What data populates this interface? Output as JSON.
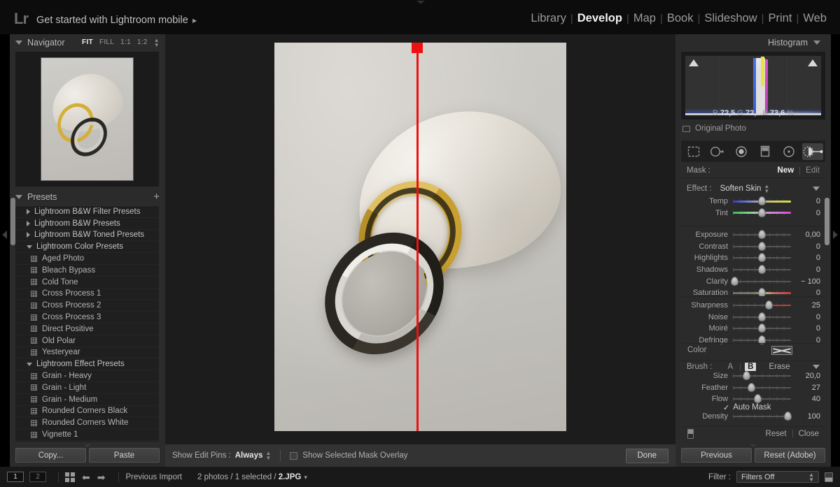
{
  "app": {
    "logo": "Lr",
    "identity_plate": "Get started with Lightroom mobile",
    "identity_arrow": "▶"
  },
  "modules": [
    {
      "label": "Library",
      "active": false
    },
    {
      "label": "Develop",
      "active": true
    },
    {
      "label": "Map",
      "active": false
    },
    {
      "label": "Book",
      "active": false
    },
    {
      "label": "Slideshow",
      "active": false
    },
    {
      "label": "Print",
      "active": false
    },
    {
      "label": "Web",
      "active": false
    }
  ],
  "module_separator": "|",
  "left_panel": {
    "navigator": {
      "title": "Navigator",
      "zoom_levels": [
        {
          "label": "FIT",
          "active": true
        },
        {
          "label": "FILL",
          "active": false
        },
        {
          "label": "1:1",
          "active": false
        },
        {
          "label": "1:2",
          "active": false
        }
      ]
    },
    "presets": {
      "title": "Presets",
      "add_label": "+",
      "items": [
        {
          "label": "Lightroom B&W Filter Presets",
          "type": "group",
          "expanded": false
        },
        {
          "label": "Lightroom B&W Presets",
          "type": "group",
          "expanded": false
        },
        {
          "label": "Lightroom B&W Toned Presets",
          "type": "group",
          "expanded": false
        },
        {
          "label": "Lightroom Color Presets",
          "type": "group",
          "expanded": true
        },
        {
          "label": "Aged Photo",
          "type": "preset"
        },
        {
          "label": "Bleach Bypass",
          "type": "preset"
        },
        {
          "label": "Cold Tone",
          "type": "preset"
        },
        {
          "label": "Cross Process 1",
          "type": "preset"
        },
        {
          "label": "Cross Process 2",
          "type": "preset"
        },
        {
          "label": "Cross Process 3",
          "type": "preset"
        },
        {
          "label": "Direct Positive",
          "type": "preset"
        },
        {
          "label": "Old Polar",
          "type": "preset"
        },
        {
          "label": "Yesteryear",
          "type": "preset"
        },
        {
          "label": "Lightroom Effect Presets",
          "type": "group",
          "expanded": true
        },
        {
          "label": "Grain - Heavy",
          "type": "preset"
        },
        {
          "label": "Grain - Light",
          "type": "preset"
        },
        {
          "label": "Grain - Medium",
          "type": "preset"
        },
        {
          "label": "Rounded Corners Black",
          "type": "preset"
        },
        {
          "label": "Rounded Corners White",
          "type": "preset"
        },
        {
          "label": "Vignette 1",
          "type": "preset"
        }
      ]
    },
    "buttons": {
      "copy": "Copy...",
      "paste": "Paste"
    }
  },
  "toolbar": {
    "show_edit_pins_label": "Show Edit Pins :",
    "show_edit_pins_value": "Always",
    "mask_overlay_label": "Show Selected Mask Overlay",
    "mask_overlay_checked": false,
    "done_label": "Done"
  },
  "right_panel": {
    "histogram": {
      "title": "Histogram",
      "readout_r_label": "R",
      "readout_r": "72,5",
      "readout_g_label": "G",
      "readout_g": "72,0",
      "readout_b_label": "B",
      "readout_b": "73,6",
      "readout_unit": "%",
      "original_photo_label": "Original Photo"
    },
    "tools": [
      {
        "name": "crop-overlay-tool",
        "active": false
      },
      {
        "name": "spot-removal-tool",
        "active": false
      },
      {
        "name": "red-eye-correction-tool",
        "active": false
      },
      {
        "name": "graduated-filter-tool",
        "active": false
      },
      {
        "name": "radial-filter-tool",
        "active": false
      },
      {
        "name": "adjustment-brush-tool",
        "active": true
      }
    ],
    "mask": {
      "label": "Mask :",
      "new_label": "New",
      "edit_label": "Edit",
      "separator": "|"
    },
    "effect": {
      "label": "Effect :",
      "value": "Soften Skin"
    },
    "sliders_group_1": [
      {
        "name": "Temp",
        "value": "0",
        "pos": 50,
        "grad": "grad-temp"
      },
      {
        "name": "Tint",
        "value": "0",
        "pos": 50,
        "grad": "grad-tint"
      }
    ],
    "sliders_group_2": [
      {
        "name": "Exposure",
        "value": "0,00",
        "pos": 50,
        "grad": ""
      },
      {
        "name": "Contrast",
        "value": "0",
        "pos": 50,
        "grad": ""
      },
      {
        "name": "Highlights",
        "value": "0",
        "pos": 50,
        "grad": ""
      },
      {
        "name": "Shadows",
        "value": "0",
        "pos": 50,
        "grad": ""
      },
      {
        "name": "Clarity",
        "value": "− 100",
        "pos": 3,
        "grad": ""
      },
      {
        "name": "Saturation",
        "value": "0",
        "pos": 50,
        "grad": "grad-sat"
      }
    ],
    "sliders_group_3": [
      {
        "name": "Sharpness",
        "value": "25",
        "pos": 62,
        "grad": "red-right"
      },
      {
        "name": "Noise",
        "value": "0",
        "pos": 50,
        "grad": ""
      },
      {
        "name": "Moiré",
        "value": "0",
        "pos": 50,
        "grad": ""
      },
      {
        "name": "Defringe",
        "value": "0",
        "pos": 50,
        "grad": ""
      }
    ],
    "color": {
      "label": "Color"
    },
    "brush": {
      "label": "Brush :",
      "a_label": "A",
      "b_label": "B",
      "separator": "|",
      "erase_label": "Erase",
      "sliders": [
        {
          "name": "Size",
          "value": "20,0",
          "pos": 24,
          "grad": ""
        },
        {
          "name": "Feather",
          "value": "27",
          "pos": 32,
          "grad": ""
        },
        {
          "name": "Flow",
          "value": "40",
          "pos": 43,
          "grad": ""
        }
      ],
      "auto_mask_label": "Auto Mask",
      "auto_mask_checked": true,
      "auto_mask_check": "✓",
      "density": {
        "name": "Density",
        "value": "100",
        "pos": 95,
        "grad": ""
      }
    },
    "footer": {
      "reset": "Reset",
      "close": "Close",
      "separator": "|"
    },
    "buttons": {
      "previous": "Previous",
      "reset_adobe": "Reset (Adobe)"
    }
  },
  "filmstrip": {
    "screen_1": "1",
    "screen_2": "2",
    "grid_icon": "grid-view-icon",
    "arrow_back": "⬅",
    "arrow_forward": "➡",
    "source_label": "Previous Import",
    "count_prefix": "2 photos / 1 selected / ",
    "selected_file": "2.JPG",
    "count_caret": "▾",
    "filter_label": "Filter :",
    "filter_value": "Filters Off"
  },
  "colors": {
    "panel_bg": "#2b2b2b",
    "center_bg": "#1c1c1c",
    "accent_red": "#ee1111",
    "text_primary": "#cfcfcf",
    "text_dim": "#9a9a9a"
  }
}
